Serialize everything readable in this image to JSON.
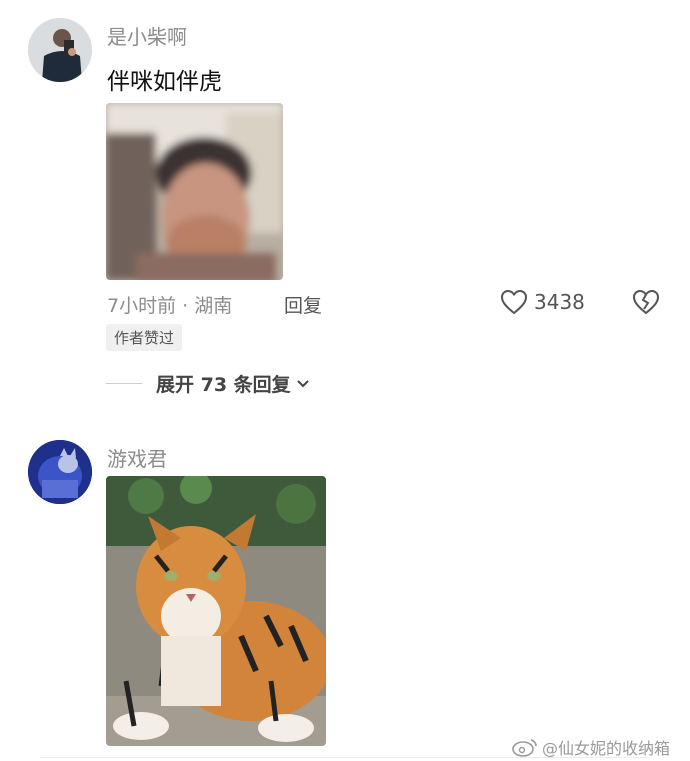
{
  "comments": [
    {
      "username": "是小柴啊",
      "text": "伴咪如伴虎",
      "time_location": "7小时前 · 湖南",
      "reply_label": "回复",
      "likes": "3438",
      "author_badge": "作者赞过",
      "expand_replies": "展开 73 条回复",
      "avatar_icon": "user-avatar",
      "image": "blurry-person-covering-mouth-photo"
    },
    {
      "username": "游戏君",
      "avatar_icon": "user-avatar",
      "image": "tiger-lying-photo"
    }
  ],
  "watermark": "@仙女妮的收纳箱",
  "icons": {
    "like": "heart-outline-icon",
    "dislike": "broken-heart-icon",
    "chevron": "chevron-down-icon",
    "weibo": "weibo-logo-icon"
  }
}
